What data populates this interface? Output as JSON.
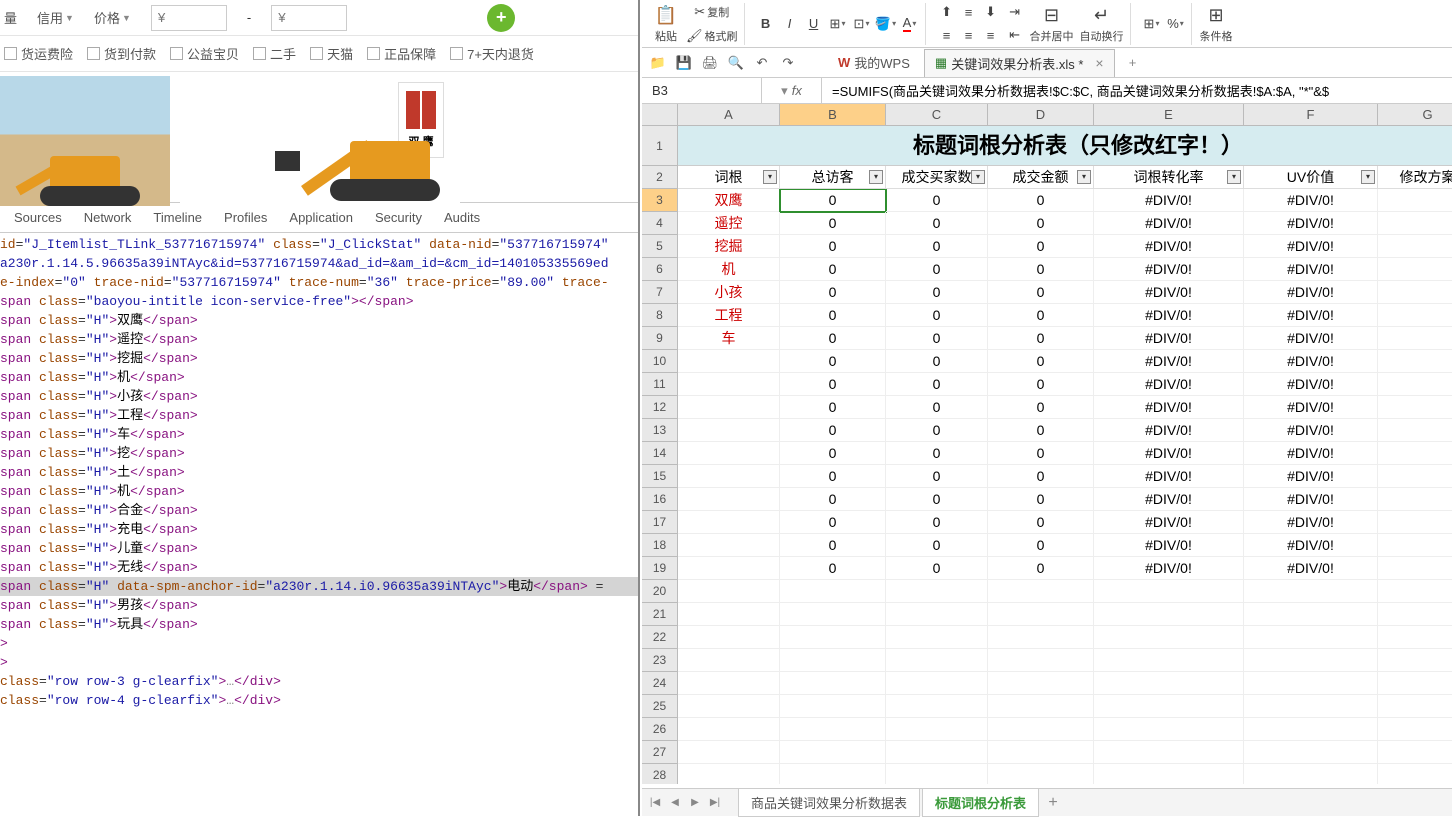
{
  "left": {
    "filters": {
      "amount": "量",
      "credit": "信用",
      "price": "价格",
      "currency": "¥"
    },
    "checkboxes": [
      "货运费险",
      "货到付款",
      "公益宝贝",
      "二手",
      "天猫",
      "正品保障",
      "7+天内退货"
    ],
    "logo_text": "双 鹰",
    "devtools_tabs": [
      "Sources",
      "Network",
      "Timeline",
      "Profiles",
      "Application",
      "Security",
      "Audits"
    ],
    "dom": {
      "line1_id": "J_Itemlist_TLink_537716715974",
      "line1_class": "J_ClickStat",
      "line1_nid": "537716715974",
      "line2": "a230r.1.14.5.96635a39iNTAyc&id=537716715974&ad_id=&am_id=&cm_id=140105335569ed",
      "line3_attrs": {
        "e-index": "0",
        "trace-nid": "537716715974",
        "trace-num": "36",
        "trace-price": "89.00",
        "trace": "trace-"
      },
      "span_baoyou": "baoyou-intitle icon-service-free",
      "keywords": [
        "双鹰",
        "遥控",
        "挖掘",
        "机",
        "小孩",
        "工程",
        "车",
        "挖",
        "土",
        "机",
        "合金",
        "充电",
        "儿童",
        "无线"
      ],
      "highlight_anchor": "a230r.1.14.i0.96635a39iNTAyc",
      "highlight_text": "电动",
      "after": [
        "男孩",
        "玩具"
      ],
      "rows": [
        "row row-3 g-clearfix",
        "row row-4 g-clearfix"
      ]
    }
  },
  "right": {
    "ribbon": {
      "paste": "粘贴",
      "copy": "复制",
      "format_brush": "格式刷",
      "merge": "合并居中",
      "wrap": "自动换行",
      "cond": "条件格"
    },
    "tabbar": {
      "wps": "我的WPS",
      "file": "关键词效果分析表.xls *"
    },
    "cell_ref": "B3",
    "formula": "=SUMIFS(商品关键词效果分析数据表!$C:$C, 商品关键词效果分析数据表!$A:$A, \"*\"&$",
    "title": "标题词根分析表（只修改红字！）",
    "headers": [
      "词根",
      "总访客",
      "成交买家数",
      "成交金额",
      "词根转化率",
      "UV价值",
      "修改方案"
    ],
    "cols": [
      "A",
      "B",
      "C",
      "D",
      "E",
      "F",
      "G"
    ],
    "roots": [
      "双鹰",
      "遥控",
      "挖掘",
      "机",
      "小孩",
      "工程",
      "车"
    ],
    "zero": "0",
    "div0": "#DIV/0!",
    "row_nums": [
      3,
      4,
      5,
      6,
      7,
      8,
      9,
      10,
      11,
      12,
      13,
      14,
      15,
      16,
      17,
      18,
      19,
      20,
      21,
      22,
      23,
      24,
      25,
      26,
      27,
      28
    ],
    "sheet_tabs": [
      "商品关键词效果分析数据表",
      "标题词根分析表"
    ]
  },
  "chart_data": {
    "type": "table",
    "title": "标题词根分析表（只修改红字！）",
    "columns": [
      "词根",
      "总访客",
      "成交买家数",
      "成交金额",
      "词根转化率",
      "UV价值",
      "修改方案"
    ],
    "rows": [
      {
        "词根": "双鹰",
        "总访客": 0,
        "成交买家数": 0,
        "成交金额": 0,
        "词根转化率": "#DIV/0!",
        "UV价值": "#DIV/0!"
      },
      {
        "词根": "遥控",
        "总访客": 0,
        "成交买家数": 0,
        "成交金额": 0,
        "词根转化率": "#DIV/0!",
        "UV价值": "#DIV/0!"
      },
      {
        "词根": "挖掘",
        "总访客": 0,
        "成交买家数": 0,
        "成交金额": 0,
        "词根转化率": "#DIV/0!",
        "UV价值": "#DIV/0!"
      },
      {
        "词根": "机",
        "总访客": 0,
        "成交买家数": 0,
        "成交金额": 0,
        "词根转化率": "#DIV/0!",
        "UV价值": "#DIV/0!"
      },
      {
        "词根": "小孩",
        "总访客": 0,
        "成交买家数": 0,
        "成交金额": 0,
        "词根转化率": "#DIV/0!",
        "UV价值": "#DIV/0!"
      },
      {
        "词根": "工程",
        "总访客": 0,
        "成交买家数": 0,
        "成交金额": 0,
        "词根转化率": "#DIV/0!",
        "UV价值": "#DIV/0!"
      },
      {
        "词根": "车",
        "总访客": 0,
        "成交买家数": 0,
        "成交金额": 0,
        "词根转化率": "#DIV/0!",
        "UV价值": "#DIV/0!"
      }
    ]
  }
}
